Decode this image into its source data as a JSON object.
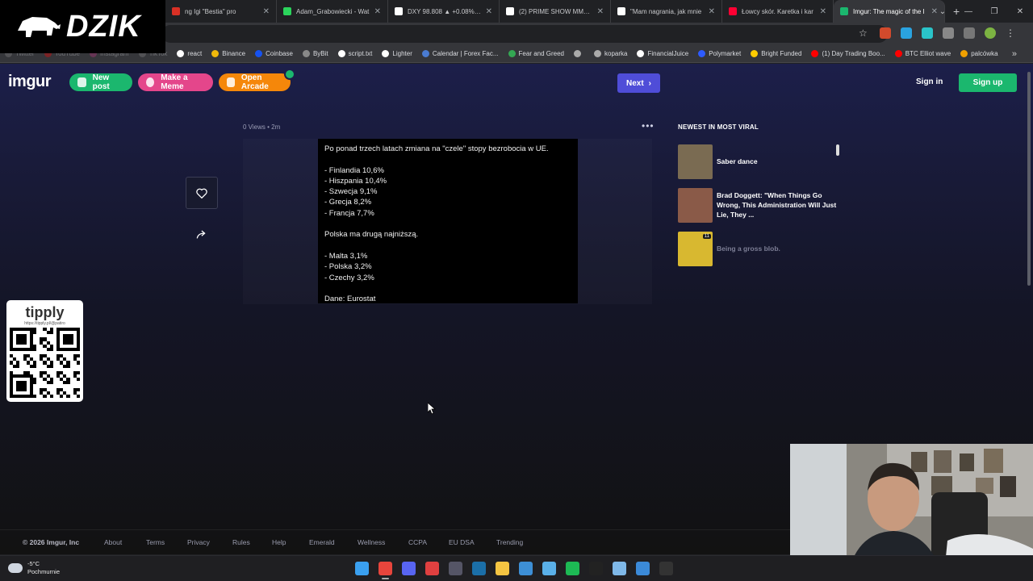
{
  "browser": {
    "tabs": [
      {
        "label": "ng Igi \"Bestia\" pro",
        "color": "#d93025"
      },
      {
        "label": "Adam_Grabowiecki - Wat",
        "color": "#2bd45c"
      },
      {
        "label": "DXY 98.808 ▲ +0.08% Be",
        "color": "#ffffff"
      },
      {
        "label": "(2) PRIME SHOW MMA or",
        "color": "#ffffff"
      },
      {
        "label": "\"Mam nagrania, jak mnie",
        "color": "#ffffff"
      },
      {
        "label": "Łowcy skór. Karetka i kar",
        "color": "#ff0033"
      },
      {
        "label": "Imgur: The magic of the I",
        "color": "#1bb76e"
      }
    ],
    "active_tab_index": 6,
    "bookmarks": [
      {
        "label": "Twitter",
        "color": "#888888",
        "dim": true
      },
      {
        "label": "YouTube",
        "color": "#ff0000",
        "dim": true
      },
      {
        "label": "Instagram",
        "color": "#c13584",
        "dim": true
      },
      {
        "label": "TikTok",
        "color": "#888888",
        "dim": true
      },
      {
        "label": "react",
        "color": "#ffffff",
        "dim": false
      },
      {
        "label": "Binance",
        "color": "#f0b90b",
        "dim": false
      },
      {
        "label": "Coinbase",
        "color": "#1652f0",
        "dim": false
      },
      {
        "label": "ByBit",
        "color": "#888888",
        "dim": false
      },
      {
        "label": "script.txt",
        "color": "#ffffff",
        "dim": false
      },
      {
        "label": "Lighter",
        "color": "#ffffff",
        "dim": false
      },
      {
        "label": "Calendar | Forex Fac...",
        "color": "#4a7bd1",
        "dim": false
      },
      {
        "label": "Fear and Greed",
        "color": "#34a853",
        "dim": false
      },
      {
        "label": "",
        "color": "#aaaaaa",
        "dim": false
      },
      {
        "label": "koparka",
        "color": "#aaaaaa",
        "dim": false
      },
      {
        "label": "FinancialJuice",
        "color": "#ffffff",
        "dim": false
      },
      {
        "label": "Polymarket",
        "color": "#2d5bff",
        "dim": false
      },
      {
        "label": "Bright Funded",
        "color": "#ffcc00",
        "dim": false
      },
      {
        "label": "(1) Day Trading Boo...",
        "color": "#ff0000",
        "dim": false
      },
      {
        "label": "BTC Elliot wave",
        "color": "#ff0000",
        "dim": false
      },
      {
        "label": "palcówka",
        "color": "#f0a000",
        "dim": false
      }
    ],
    "more_bookmarks": "»"
  },
  "overlay": {
    "brand": "DZIK",
    "tipply_logo": "tipply",
    "tipply_url": "https://tipply.pl/@patiro"
  },
  "imgur": {
    "logo": "imgur",
    "new_post": "New post",
    "make_meme": "Make a Meme",
    "open_arcade": "Open Arcade",
    "next": "Next",
    "sign_in": "Sign in",
    "sign_up": "Sign up",
    "meta": "0 Views • 2m",
    "more": "•••",
    "post_lines": [
      "Po ponad trzech latach zmiana na \"czele\" stopy bezrobocia w UE.",
      "",
      "- Finlandia 10,6%",
      "- Hiszpania 10,4%",
      "- Szwecja 9,1%",
      "- Grecja 8,2%",
      "- Francja 7,7%",
      "",
      "Polska ma drugą najniższą.",
      "",
      "- Malta 3,1%",
      "- Polska 3,2%",
      "- Czechy 3,2%",
      "",
      "Dane: Eurostat"
    ],
    "viral_title": "NEWEST IN MOST VIRAL",
    "viral": [
      {
        "title": "Saber dance",
        "thumb": "#7a6b52",
        "count": ""
      },
      {
        "title": "Brad Doggett: \"When Things Go Wrong, This Administration Will Just Lie, They ...",
        "thumb": "#8a5a48",
        "count": ""
      },
      {
        "title": "Being a gross blob.",
        "thumb": "#d8b830",
        "count": "11"
      }
    ],
    "footer": {
      "copyright": "© 2026 Imgur, Inc",
      "links": [
        "About",
        "Terms",
        "Privacy",
        "Rules",
        "Help",
        "Emerald",
        "Wellness",
        "CCPA",
        "EU DSA",
        "Trending"
      ]
    }
  },
  "taskbar": {
    "temp": "-5°C",
    "weather": "Pochmurnie",
    "apps": [
      {
        "name": "windows-start",
        "color": "#3aa0f0"
      },
      {
        "name": "chrome",
        "color": "#e8453c"
      },
      {
        "name": "discord",
        "color": "#5865f2"
      },
      {
        "name": "app-red",
        "color": "#e04040"
      },
      {
        "name": "obs",
        "color": "#555566"
      },
      {
        "name": "steam",
        "color": "#1b6fa8"
      },
      {
        "name": "explorer",
        "color": "#f5c542"
      },
      {
        "name": "ccleaner",
        "color": "#3d8fd6"
      },
      {
        "name": "app-tools",
        "color": "#5ab0e8"
      },
      {
        "name": "spotify",
        "color": "#1db954"
      },
      {
        "name": "app-black",
        "color": "#222222"
      },
      {
        "name": "notepad",
        "color": "#7fb8e8"
      },
      {
        "name": "photos",
        "color": "#3b8ad8"
      },
      {
        "name": "terminal",
        "color": "#333333"
      }
    ]
  }
}
